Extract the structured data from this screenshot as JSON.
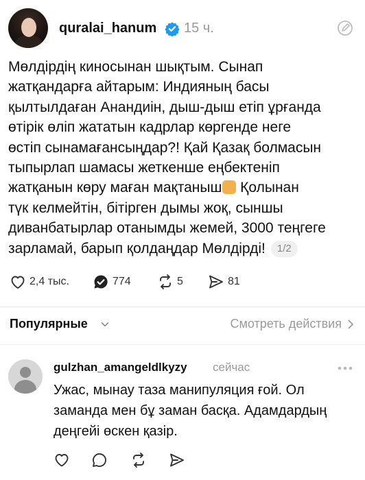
{
  "post": {
    "author": {
      "username": "quralai_hanum",
      "time": "15 ч.",
      "avatar_icon": "avatar-photo",
      "verified_icon": "verified-badge-icon"
    },
    "text_lines": [
      "Мөлдірдің киносынан шықтым. Сынап",
      "жатқандарға айтарым: Индияның басы",
      "қылтылдаған Анандиін, дыш-дыш етіп ұрғанда",
      "өтірік өліп жататын кадрлар көргенде неге",
      "өстіп сынамағансыңдар?! Қай Қазақ болмасын",
      "тыпырлап шамасы жеткенше еңбектеніп",
      "жатқанын көру маған мақтаныш",
      "түк келмейтін, бітірген дымы жоқ, сыншы",
      "диванбатырлар отанымды жемей, 3000 теңгеге",
      "зарламай, барып қолдаңдар Мөлдірді!"
    ],
    "line7_tail": "Қолынан",
    "flex_emoji": "flexed-biceps-emoji",
    "pager": "1/2",
    "stats": {
      "likes": "2,4 тыс.",
      "comments": "774",
      "reposts": "5",
      "shares": "81"
    }
  },
  "popular": {
    "label": "Популярные",
    "actions_link": "Смотреть действия"
  },
  "reply": {
    "username": "gulzhan_amangeldlkyzy",
    "time": "сейчас",
    "text_lines": [
      "Ужас, мынау таза манипуляция ғой. Ол",
      "заманда мен бұ заман басқа. Адамдардың",
      "деңгейі өскен қазір."
    ]
  },
  "colors": {
    "verified": "#1d9bf0",
    "muted": "#999999",
    "text": "#111111"
  }
}
